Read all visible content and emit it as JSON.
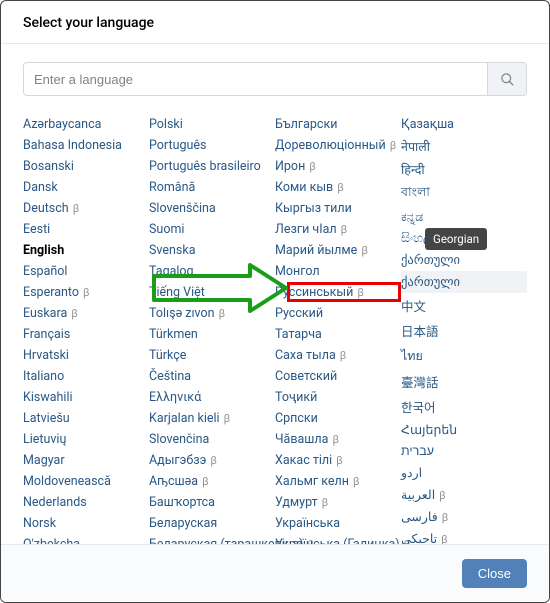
{
  "header": {
    "title": "Select your language"
  },
  "search": {
    "placeholder": "Enter a language",
    "value": ""
  },
  "columns": [
    [
      {
        "label": "Azərbaycanca",
        "beta": false
      },
      {
        "label": "Bahasa Indonesia",
        "beta": false
      },
      {
        "label": "Bosanski",
        "beta": false
      },
      {
        "label": "Dansk",
        "beta": false
      },
      {
        "label": "Deutsch",
        "beta": true
      },
      {
        "label": "Eesti",
        "beta": false
      },
      {
        "label": "English",
        "beta": false,
        "current": true
      },
      {
        "label": "Español",
        "beta": false
      },
      {
        "label": "Esperanto",
        "beta": true
      },
      {
        "label": "Euskara",
        "beta": true
      },
      {
        "label": "Français",
        "beta": false
      },
      {
        "label": "Hrvatski",
        "beta": false
      },
      {
        "label": "Italiano",
        "beta": false
      },
      {
        "label": "Kiswahili",
        "beta": false
      },
      {
        "label": "Latviešu",
        "beta": false
      },
      {
        "label": "Lietuvių",
        "beta": false
      },
      {
        "label": "Magyar",
        "beta": false
      },
      {
        "label": "Moldovenească",
        "beta": false
      },
      {
        "label": "Nederlands",
        "beta": false
      },
      {
        "label": "Norsk",
        "beta": false
      },
      {
        "label": "O'zbekcha",
        "beta": false
      }
    ],
    [
      {
        "label": "Polski",
        "beta": false
      },
      {
        "label": "Português",
        "beta": false
      },
      {
        "label": "Português brasileiro",
        "beta": false
      },
      {
        "label": "Română",
        "beta": false
      },
      {
        "label": "Slovenščina",
        "beta": false
      },
      {
        "label": "Suomi",
        "beta": false
      },
      {
        "label": "Svenska",
        "beta": false
      },
      {
        "label": "Tagalog",
        "beta": false
      },
      {
        "label": "Tiếng Việt",
        "beta": false
      },
      {
        "label": "Tolışə zıvon",
        "beta": true
      },
      {
        "label": "Türkmen",
        "beta": false
      },
      {
        "label": "Türkçe",
        "beta": false
      },
      {
        "label": "Čeština",
        "beta": false
      },
      {
        "label": "Ελληνικά",
        "beta": false
      },
      {
        "label": "Karjalan kieli",
        "beta": true
      },
      {
        "label": "Slovenčina",
        "beta": false
      },
      {
        "label": "Адыгэбзэ",
        "beta": true
      },
      {
        "label": "Аҧсшәа",
        "beta": true
      },
      {
        "label": "Башҡортса",
        "beta": false
      },
      {
        "label": "Беларуская",
        "beta": false
      },
      {
        "label": "Беларуская (тарашкевіца)",
        "beta": true
      }
    ],
    [
      {
        "label": "Български",
        "beta": false
      },
      {
        "label": "Дореволюціонный",
        "beta": true
      },
      {
        "label": "Ирон",
        "beta": true
      },
      {
        "label": "Коми кыв",
        "beta": true
      },
      {
        "label": "Кыргыз тили",
        "beta": false
      },
      {
        "label": "Лезги чІал",
        "beta": true
      },
      {
        "label": "Марий йылме",
        "beta": true
      },
      {
        "label": "Монгол",
        "beta": false
      },
      {
        "label": "Руссинськый",
        "beta": true
      },
      {
        "label": "Русский",
        "beta": false,
        "highlight": true
      },
      {
        "label": "Татарча",
        "beta": false
      },
      {
        "label": "Саха тыла",
        "beta": true
      },
      {
        "label": "Советский",
        "beta": false
      },
      {
        "label": "Тоҷикӣ",
        "beta": false
      },
      {
        "label": "Српски",
        "beta": false
      },
      {
        "label": "Чӑвашла",
        "beta": true
      },
      {
        "label": "Хакас тілі",
        "beta": true
      },
      {
        "label": "Хальмг келн",
        "beta": true
      },
      {
        "label": "Удмурт",
        "beta": true
      },
      {
        "label": "Українська",
        "beta": false
      },
      {
        "label": "Українська (Галицка)",
        "beta": true
      }
    ],
    [
      {
        "label": "Қазақша",
        "beta": false
      },
      {
        "label": "नेपाली",
        "beta": false
      },
      {
        "label": "हिन्दी",
        "beta": false
      },
      {
        "label": "বাংলা",
        "beta": false
      },
      {
        "label": "ಕನ್ನಡ",
        "beta": false
      },
      {
        "label": "සිංහල",
        "beta": false
      },
      {
        "label": "ქართული",
        "beta": false,
        "tooltip": "Georgian"
      },
      {
        "label": "ქართული",
        "beta": false,
        "sel": true
      },
      {
        "label": "中文",
        "beta": false
      },
      {
        "label": "日本語",
        "beta": false
      },
      {
        "label": "ไทย",
        "beta": false
      },
      {
        "label": "臺灣話",
        "beta": false
      },
      {
        "label": "한국어",
        "beta": false
      },
      {
        "label": "Հայերեն",
        "beta": false
      },
      {
        "label": "עברית",
        "beta": false
      },
      {
        "label": "اردو",
        "beta": false
      },
      {
        "label": "العربية",
        "beta": true
      },
      {
        "label": "فارسی",
        "beta": true
      },
      {
        "label": "تاجیکی",
        "beta": true
      }
    ]
  ],
  "footer": {
    "close": "Close"
  },
  "tooltip_text": "Georgian",
  "beta_glyph": "β"
}
